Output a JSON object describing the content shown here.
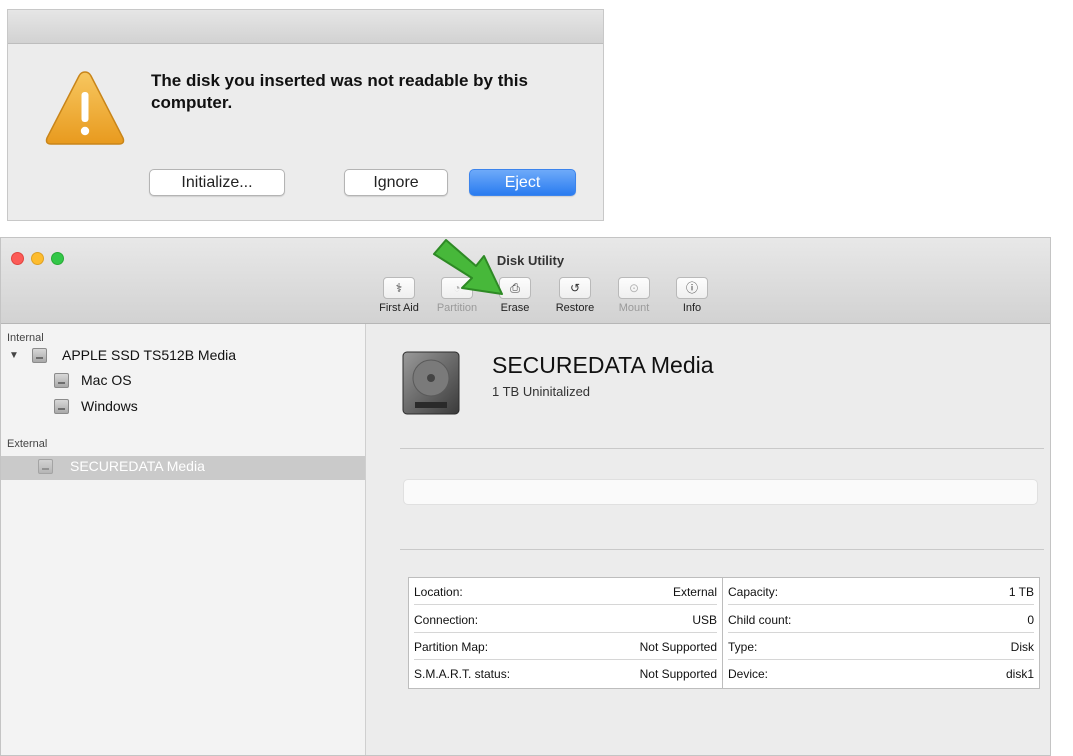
{
  "alert": {
    "message": "The disk you inserted was not readable by this computer.",
    "buttons": {
      "initialize": "Initialize...",
      "ignore": "Ignore",
      "eject": "Eject"
    },
    "eject_color": "#2a7cf0",
    "icon": "warning-icon"
  },
  "window": {
    "title": "Disk Utility",
    "toolbar": [
      {
        "label": "First Aid",
        "icon": "stethoscope-icon",
        "glyph": "⚕",
        "enabled": true
      },
      {
        "label": "Partition",
        "icon": "pie-chart-icon",
        "glyph": "◔",
        "enabled": false
      },
      {
        "label": "Erase",
        "icon": "erase-icon",
        "glyph": "⎙",
        "enabled": true
      },
      {
        "label": "Restore",
        "icon": "restore-icon",
        "glyph": "↺",
        "enabled": true
      },
      {
        "label": "Mount",
        "icon": "mount-icon",
        "glyph": "⊙",
        "enabled": false
      },
      {
        "label": "Info",
        "icon": "info-icon",
        "glyph": "ⓘ",
        "enabled": true
      }
    ],
    "highlight_arrow_color": "#47b83a"
  },
  "sidebar": {
    "internal_label": "Internal",
    "external_label": "External",
    "internal_disk": "APPLE SSD TS512B Media",
    "volumes": [
      "Mac OS",
      "Windows"
    ],
    "external_disk": "SECUREDATA Media"
  },
  "detail": {
    "name": "SECUREDATA Media",
    "subtitle": "1 TB Uninitalized",
    "left": [
      {
        "k": "Location:",
        "v": "External"
      },
      {
        "k": "Connection:",
        "v": "USB"
      },
      {
        "k": "Partition Map:",
        "v": "Not Supported"
      },
      {
        "k": "S.M.A.R.T. status:",
        "v": "Not Supported"
      }
    ],
    "right": [
      {
        "k": "Capacity:",
        "v": "1 TB"
      },
      {
        "k": "Child count:",
        "v": "0"
      },
      {
        "k": "Type:",
        "v": "Disk"
      },
      {
        "k": "Device:",
        "v": "disk1"
      }
    ]
  }
}
